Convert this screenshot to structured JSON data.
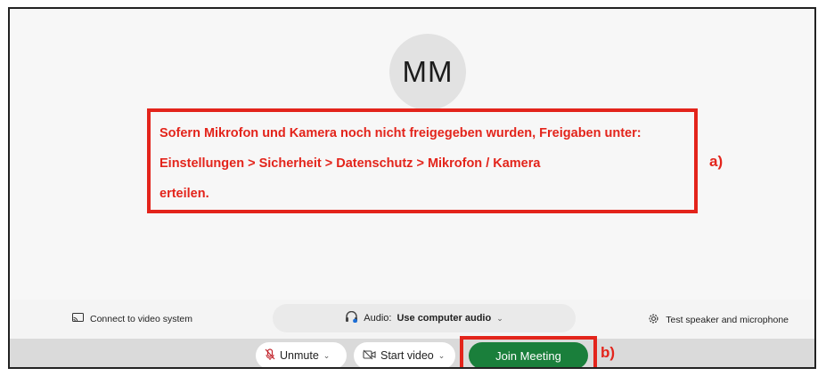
{
  "avatar": {
    "initials": "MM"
  },
  "note": {
    "lines": [
      "Sofern Mikrofon und Kamera noch nicht freigegeben wurden, Freigaben unter:",
      "Einstellungen > Sicherheit > Datenschutz > Mikrofon / Kamera",
      "erteilen."
    ],
    "marker_a": "a)",
    "marker_b": "b)",
    "highlight_color": "#e3241b"
  },
  "toolbar": {
    "connect_label": "Connect to video system",
    "audio_prefix": "Audio:",
    "audio_value": "Use computer audio",
    "test_label": "Test speaker and microphone"
  },
  "controls": {
    "unmute_label": "Unmute",
    "start_video_label": "Start video",
    "join_label": "Join Meeting",
    "join_color": "#1a7f3b"
  }
}
